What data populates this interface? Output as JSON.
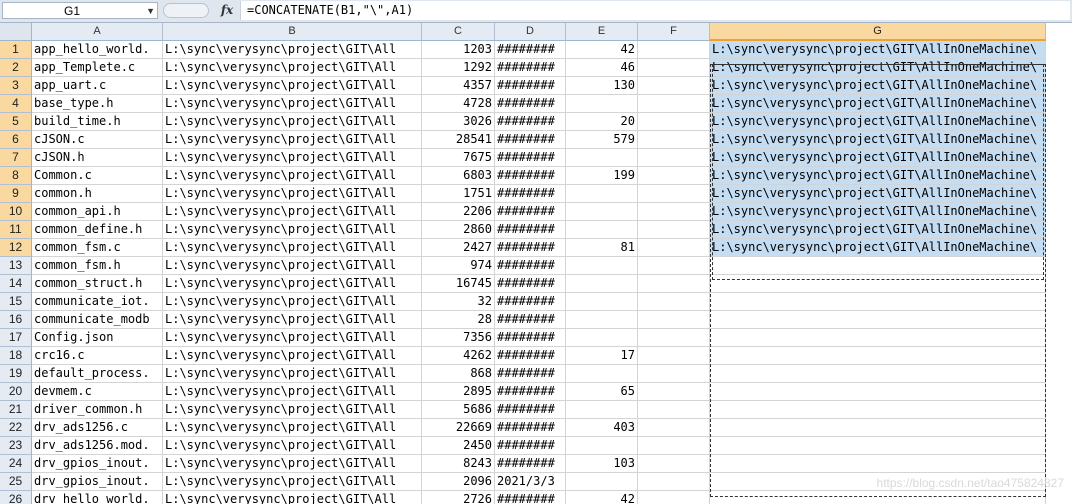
{
  "formula_bar": {
    "name_box": "G1",
    "fx_label": "fx",
    "formula": "=CONCATENATE(B1,\"\\\",A1)"
  },
  "columns": [
    "A",
    "B",
    "C",
    "D",
    "E",
    "F",
    "G"
  ],
  "selected_column": "G",
  "selected_rows": [
    "1",
    "2",
    "3",
    "4",
    "5",
    "6",
    "7",
    "8",
    "9",
    "10",
    "11",
    "12"
  ],
  "rows": [
    {
      "n": "1",
      "a": "app_hello_world.",
      "b": "L:\\sync\\verysync\\project\\GIT\\All",
      "c": "1203",
      "d": "########",
      "e": "42",
      "g": "L:\\sync\\verysync\\project\\GIT\\AllInOneMachine\\"
    },
    {
      "n": "2",
      "a": "app_Templete.c",
      "b": "L:\\sync\\verysync\\project\\GIT\\All",
      "c": "1292",
      "d": "########",
      "e": "46",
      "g": "L:\\sync\\verysync\\project\\GIT\\AllInOneMachine\\"
    },
    {
      "n": "3",
      "a": "app_uart.c",
      "b": "L:\\sync\\verysync\\project\\GIT\\All",
      "c": "4357",
      "d": "########",
      "e": "130",
      "g": "L:\\sync\\verysync\\project\\GIT\\AllInOneMachine\\"
    },
    {
      "n": "4",
      "a": "base_type.h",
      "b": "L:\\sync\\verysync\\project\\GIT\\All",
      "c": "4728",
      "d": "########",
      "e": "",
      "g": "L:\\sync\\verysync\\project\\GIT\\AllInOneMachine\\"
    },
    {
      "n": "5",
      "a": "build_time.h",
      "b": "L:\\sync\\verysync\\project\\GIT\\All",
      "c": "3026",
      "d": "########",
      "e": "20",
      "g": "L:\\sync\\verysync\\project\\GIT\\AllInOneMachine\\"
    },
    {
      "n": "6",
      "a": "cJSON.c",
      "b": "L:\\sync\\verysync\\project\\GIT\\All",
      "c": "28541",
      "d": "########",
      "e": "579",
      "g": "L:\\sync\\verysync\\project\\GIT\\AllInOneMachine\\"
    },
    {
      "n": "7",
      "a": "cJSON.h",
      "b": "L:\\sync\\verysync\\project\\GIT\\All",
      "c": "7675",
      "d": "########",
      "e": "",
      "g": "L:\\sync\\verysync\\project\\GIT\\AllInOneMachine\\"
    },
    {
      "n": "8",
      "a": "Common.c",
      "b": "L:\\sync\\verysync\\project\\GIT\\All",
      "c": "6803",
      "d": "########",
      "e": "199",
      "g": "L:\\sync\\verysync\\project\\GIT\\AllInOneMachine\\"
    },
    {
      "n": "9",
      "a": "common.h",
      "b": "L:\\sync\\verysync\\project\\GIT\\All",
      "c": "1751",
      "d": "########",
      "e": "",
      "g": "L:\\sync\\verysync\\project\\GIT\\AllInOneMachine\\"
    },
    {
      "n": "10",
      "a": "common_api.h",
      "b": "L:\\sync\\verysync\\project\\GIT\\All",
      "c": "2206",
      "d": "########",
      "e": "",
      "g": "L:\\sync\\verysync\\project\\GIT\\AllInOneMachine\\"
    },
    {
      "n": "11",
      "a": "common_define.h",
      "b": "L:\\sync\\verysync\\project\\GIT\\All",
      "c": "2860",
      "d": "########",
      "e": "",
      "g": "L:\\sync\\verysync\\project\\GIT\\AllInOneMachine\\"
    },
    {
      "n": "12",
      "a": "common_fsm.c",
      "b": "L:\\sync\\verysync\\project\\GIT\\All",
      "c": "2427",
      "d": "########",
      "e": "81",
      "g": "L:\\sync\\verysync\\project\\GIT\\AllInOneMachine\\"
    },
    {
      "n": "13",
      "a": "common_fsm.h",
      "b": "L:\\sync\\verysync\\project\\GIT\\All",
      "c": "974",
      "d": "########",
      "e": "",
      "g": ""
    },
    {
      "n": "14",
      "a": "common_struct.h",
      "b": "L:\\sync\\verysync\\project\\GIT\\All",
      "c": "16745",
      "d": "########",
      "e": "",
      "g": ""
    },
    {
      "n": "15",
      "a": "communicate_iot.",
      "b": "L:\\sync\\verysync\\project\\GIT\\All",
      "c": "32",
      "d": "########",
      "e": "",
      "g": ""
    },
    {
      "n": "16",
      "a": "communicate_modb",
      "b": "L:\\sync\\verysync\\project\\GIT\\All",
      "c": "28",
      "d": "########",
      "e": "",
      "g": ""
    },
    {
      "n": "17",
      "a": "Config.json",
      "b": "L:\\sync\\verysync\\project\\GIT\\All",
      "c": "7356",
      "d": "########",
      "e": "",
      "g": ""
    },
    {
      "n": "18",
      "a": "crc16.c",
      "b": "L:\\sync\\verysync\\project\\GIT\\All",
      "c": "4262",
      "d": "########",
      "e": "17",
      "g": ""
    },
    {
      "n": "19",
      "a": "default_process.",
      "b": "L:\\sync\\verysync\\project\\GIT\\All",
      "c": "868",
      "d": "########",
      "e": "",
      "g": ""
    },
    {
      "n": "20",
      "a": "devmem.c",
      "b": "L:\\sync\\verysync\\project\\GIT\\All",
      "c": "2895",
      "d": "########",
      "e": "65",
      "g": ""
    },
    {
      "n": "21",
      "a": "driver_common.h",
      "b": "L:\\sync\\verysync\\project\\GIT\\All",
      "c": "5686",
      "d": "########",
      "e": "",
      "g": ""
    },
    {
      "n": "22",
      "a": "drv_ads1256.c",
      "b": "L:\\sync\\verysync\\project\\GIT\\All",
      "c": "22669",
      "d": "########",
      "e": "403",
      "g": ""
    },
    {
      "n": "23",
      "a": "drv_ads1256.mod.",
      "b": "L:\\sync\\verysync\\project\\GIT\\All",
      "c": "2450",
      "d": "########",
      "e": "",
      "g": ""
    },
    {
      "n": "24",
      "a": "drv_gpios_inout.",
      "b": "L:\\sync\\verysync\\project\\GIT\\All",
      "c": "8243",
      "d": "########",
      "e": "103",
      "g": ""
    },
    {
      "n": "25",
      "a": "drv_gpios_inout.",
      "b": "L:\\sync\\verysync\\project\\GIT\\All",
      "c": "2096",
      "d": "2021/3/3",
      "e": "",
      "g": ""
    },
    {
      "n": "26",
      "a": "drv_hello_world.",
      "b": "L:\\sync\\verysync\\project\\GIT\\All",
      "c": "2726",
      "d": "########",
      "e": "42",
      "g": ""
    }
  ],
  "watermark": "https://blog.csdn.net/tao475824827"
}
